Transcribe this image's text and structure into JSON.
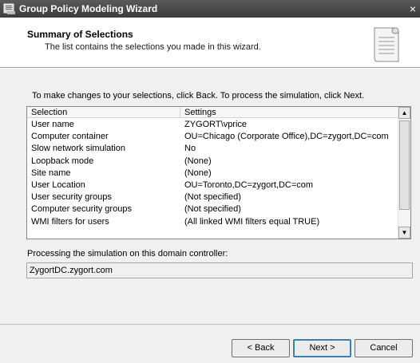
{
  "window": {
    "title": "Group Policy Modeling Wizard",
    "close_glyph": "×"
  },
  "header": {
    "title": "Summary of Selections",
    "subtitle": "The list contains the selections you made in this wizard."
  },
  "instruction": "To make changes to your selections, click Back. To process the simulation, click Next.",
  "list": {
    "columns": [
      "Selection",
      "Settings"
    ],
    "rows": [
      {
        "selection": "User name",
        "settings": "ZYGORT\\vprice"
      },
      {
        "selection": "Computer container",
        "settings": "OU=Chicago (Corporate Office),DC=zygort,DC=com"
      },
      {
        "selection": "Slow network simulation",
        "settings": "No"
      },
      {
        "selection": "Loopback mode",
        "settings": "(None)"
      },
      {
        "selection": "Site name",
        "settings": "(None)"
      },
      {
        "selection": "User Location",
        "settings": "OU=Toronto,DC=zygort,DC=com"
      },
      {
        "selection": "User security groups",
        "settings": "(Not specified)"
      },
      {
        "selection": "Computer security groups",
        "settings": "(Not specified)"
      },
      {
        "selection": "WMI filters for users",
        "settings": "(All linked WMI filters equal TRUE)"
      }
    ]
  },
  "domain_controller": {
    "label": "Processing the simulation on this domain controller:",
    "value": "ZygortDC.zygort.com"
  },
  "buttons": {
    "back": "< Back",
    "next": "Next >",
    "cancel": "Cancel"
  },
  "icons": {
    "app": "gpo-wizard-icon",
    "header": "document-icon"
  }
}
